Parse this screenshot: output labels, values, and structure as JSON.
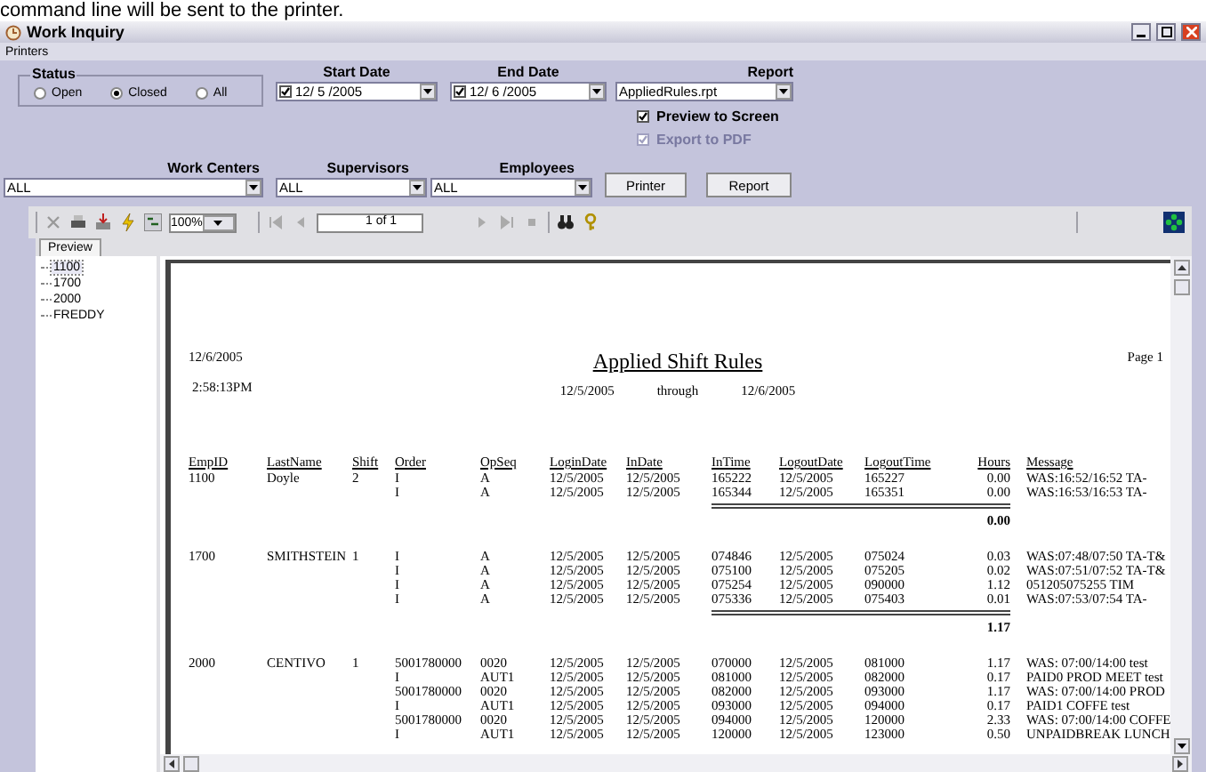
{
  "caption": "command line will be sent to the printer.",
  "window": {
    "title": "Work Inquiry"
  },
  "menu": [
    "Printers"
  ],
  "status": {
    "label": "Status",
    "options": [
      {
        "label": "Open",
        "selected": false
      },
      {
        "label": "Closed",
        "selected": true
      },
      {
        "label": "All",
        "selected": false
      }
    ]
  },
  "start_date": {
    "label": "Start Date",
    "value": "12/ 5 /2005",
    "checked": true
  },
  "end_date": {
    "label": "End Date",
    "value": "12/ 6 /2005",
    "checked": true
  },
  "report_select": {
    "label": "Report",
    "value": "AppliedRules.rpt"
  },
  "options": [
    {
      "label": "Preview to Screen",
      "checked": true,
      "disabled": false
    },
    {
      "label": "Export to PDF",
      "checked": true,
      "disabled": true
    }
  ],
  "filters": [
    {
      "label": "Work Centers",
      "value": "ALL"
    },
    {
      "label": "Supervisors",
      "value": "ALL"
    },
    {
      "label": "Employees",
      "value": "ALL"
    }
  ],
  "buttons": [
    "Printer",
    "Report"
  ],
  "toolbar": {
    "zoom": "100%",
    "page": "1 of 1"
  },
  "tabs": [
    "Preview"
  ],
  "tree": [
    {
      "label": "1100",
      "selected": true
    },
    {
      "label": "1700",
      "selected": false
    },
    {
      "label": "2000",
      "selected": false
    },
    {
      "label": "FREDDY",
      "selected": false
    }
  ],
  "report": {
    "print_date": "12/6/2005",
    "print_time": "2:58:13PM",
    "title": "Applied Shift Rules",
    "date_from": "12/5/2005",
    "through": "through",
    "date_to": "12/6/2005",
    "page": "Page 1",
    "columns": [
      "EmpID",
      "LastName",
      "Shift",
      "Order",
      "OpSeq",
      "LoginDate",
      "InDate",
      "InTime",
      "LogoutDate",
      "LogoutTime",
      "Hours",
      "Message"
    ],
    "groups": [
      {
        "emp_id": "1100",
        "last_name": "Doyle",
        "shift": "2",
        "total": "0.00",
        "rows": [
          [
            "I",
            "A",
            "12/5/2005",
            "12/5/2005",
            "165222",
            "12/5/2005",
            "165227",
            "0.00",
            "WAS:16:52/16:52  TA-"
          ],
          [
            "I",
            "A",
            "12/5/2005",
            "12/5/2005",
            "165344",
            "12/5/2005",
            "165351",
            "0.00",
            "WAS:16:53/16:53  TA-"
          ]
        ]
      },
      {
        "emp_id": "1700",
        "last_name": "SMITHSTEIN",
        "shift": "1",
        "total": "1.17",
        "rows": [
          [
            "I",
            "A",
            "12/5/2005",
            "12/5/2005",
            "074846",
            "12/5/2005",
            "075024",
            "0.03",
            "WAS:07:48/07:50  TA-T&"
          ],
          [
            "I",
            "A",
            "12/5/2005",
            "12/5/2005",
            "075100",
            "12/5/2005",
            "075205",
            "0.02",
            "WAS:07:51/07:52  TA-T&"
          ],
          [
            "I",
            "A",
            "12/5/2005",
            "12/5/2005",
            "075254",
            "12/5/2005",
            "090000",
            "1.12",
            "051205075255  TIM"
          ],
          [
            "I",
            "A",
            "12/5/2005",
            "12/5/2005",
            "075336",
            "12/5/2005",
            "075403",
            "0.01",
            "WAS:07:53/07:54  TA-"
          ]
        ]
      },
      {
        "emp_id": "2000",
        "last_name": "CENTIVO",
        "shift": "1",
        "rows": [
          [
            "5001780000",
            "0020",
            "12/5/2005",
            "12/5/2005",
            "070000",
            "12/5/2005",
            "081000",
            "1.17",
            "WAS: 07:00/14:00  test"
          ],
          [
            "I",
            "AUT1",
            "12/5/2005",
            "12/5/2005",
            "081000",
            "12/5/2005",
            "082000",
            "0.17",
            "PAID0 PROD MEET test"
          ],
          [
            "5001780000",
            "0020",
            "12/5/2005",
            "12/5/2005",
            "082000",
            "12/5/2005",
            "093000",
            "1.17",
            "WAS: 07:00/14:00 PROD"
          ],
          [
            "I",
            "AUT1",
            "12/5/2005",
            "12/5/2005",
            "093000",
            "12/5/2005",
            "094000",
            "0.17",
            "PAID1 COFFE test"
          ],
          [
            "5001780000",
            "0020",
            "12/5/2005",
            "12/5/2005",
            "094000",
            "12/5/2005",
            "120000",
            "2.33",
            "WAS: 07:00/14:00 COFFE"
          ],
          [
            "I",
            "AUT1",
            "12/5/2005",
            "12/5/2005",
            "120000",
            "12/5/2005",
            "123000",
            "0.50",
            "UNPAIDBREAK LUNCH"
          ]
        ]
      }
    ]
  }
}
